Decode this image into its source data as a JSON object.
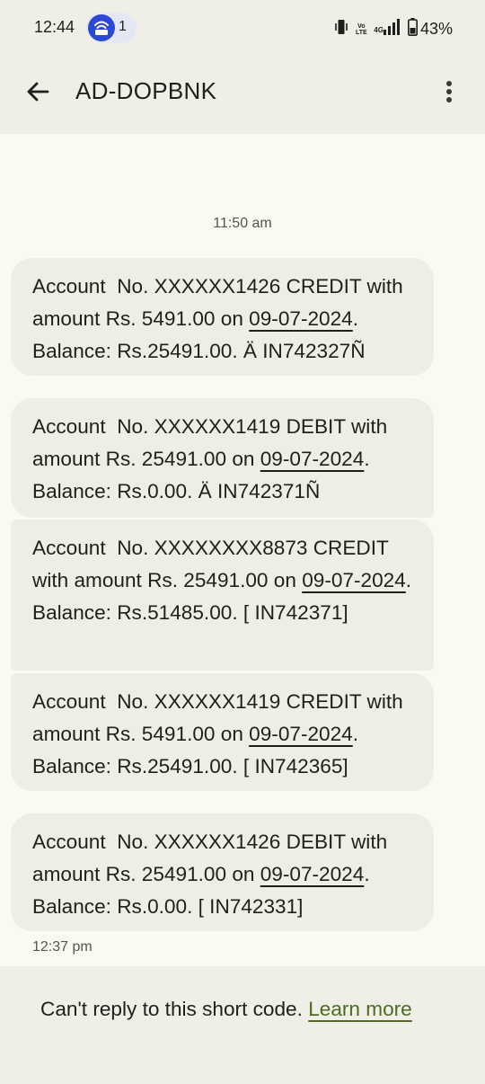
{
  "status_bar": {
    "time": "12:44",
    "notification_count": "1",
    "volte_label": "Vo LTE",
    "network_label": "4G",
    "battery_percent": "43%"
  },
  "app_bar": {
    "title": "AD-DOPBNK",
    "back_icon": "arrow-left-icon",
    "menu_icon": "more-vertical-icon"
  },
  "conversation": {
    "time_top": "11:50 am",
    "time_bottom": "12:37 pm",
    "messages": [
      {
        "before": "Account  No. XXXXXX1426 CREDIT with amount Rs. 5491.00 on ",
        "date": "09-07-2024",
        "after": ". Balance: Rs.25491.00. Ä IN742327Ñ"
      },
      {
        "before": "Account  No. XXXXXX1419 DEBIT with amount Rs. 25491.00 on ",
        "date": "09-07-2024",
        "after": ". Balance: Rs.0.00. Ä IN742371Ñ"
      },
      {
        "before": "Account  No. XXXXXXXX8873 CREDIT with amount Rs. 25491.00 on ",
        "date": "09-07-2024",
        "after": ". Balance: Rs.51485.00. [ IN742371]"
      },
      {
        "before": "Account  No. XXXXXX1419 CREDIT with amount Rs. 5491.00 on ",
        "date": "09-07-2024",
        "after": ". Balance: Rs.25491.00. [ IN742365]"
      },
      {
        "before": "Account  No. XXXXXX1426 DEBIT with amount Rs. 25491.00 on ",
        "date": "09-07-2024",
        "after": ". Balance: Rs.0.00. [ IN742331]"
      }
    ]
  },
  "footer": {
    "text": "Can't reply to this short code. ",
    "link": "Learn more"
  },
  "colors": {
    "header_bg": "#efefe7",
    "bubble_bg": "#eeeee5",
    "page_bg": "#fafaf3",
    "link": "#4f6a24",
    "notification_badge": "#2b48d6"
  }
}
